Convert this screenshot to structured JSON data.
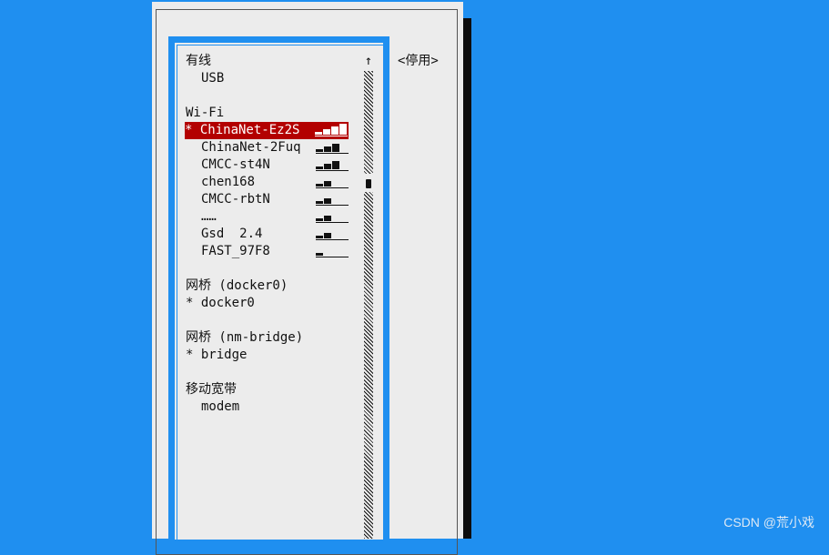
{
  "sections": {
    "wired": "有线",
    "usb": "USB",
    "wifi": "Wi-Fi",
    "bridge_docker": "网桥 (docker0)",
    "docker0": "* docker0",
    "bridge_nm": "网桥 (nm-bridge)",
    "bridge": "* bridge",
    "mobile": "移动宽带",
    "modem": "modem"
  },
  "wifi_networks": [
    {
      "label": "* ChinaNet-Ez2S",
      "signal": 4
    },
    {
      "label": "ChinaNet-2Fuq",
      "signal": 3
    },
    {
      "label": "CMCC-st4N",
      "signal": 3
    },
    {
      "label": "chen168",
      "signal": 2
    },
    {
      "label": "CMCC-rbtN",
      "signal": 2
    },
    {
      "label": "……",
      "signal": 2
    },
    {
      "label": "Gsd  2.4",
      "signal": 2
    },
    {
      "label": "FAST_97F8",
      "signal": 1
    }
  ],
  "scrollbar": {
    "up_arrow": "↑"
  },
  "actions": {
    "disable": "<停用>"
  },
  "watermark": "CSDN @荒小戏"
}
